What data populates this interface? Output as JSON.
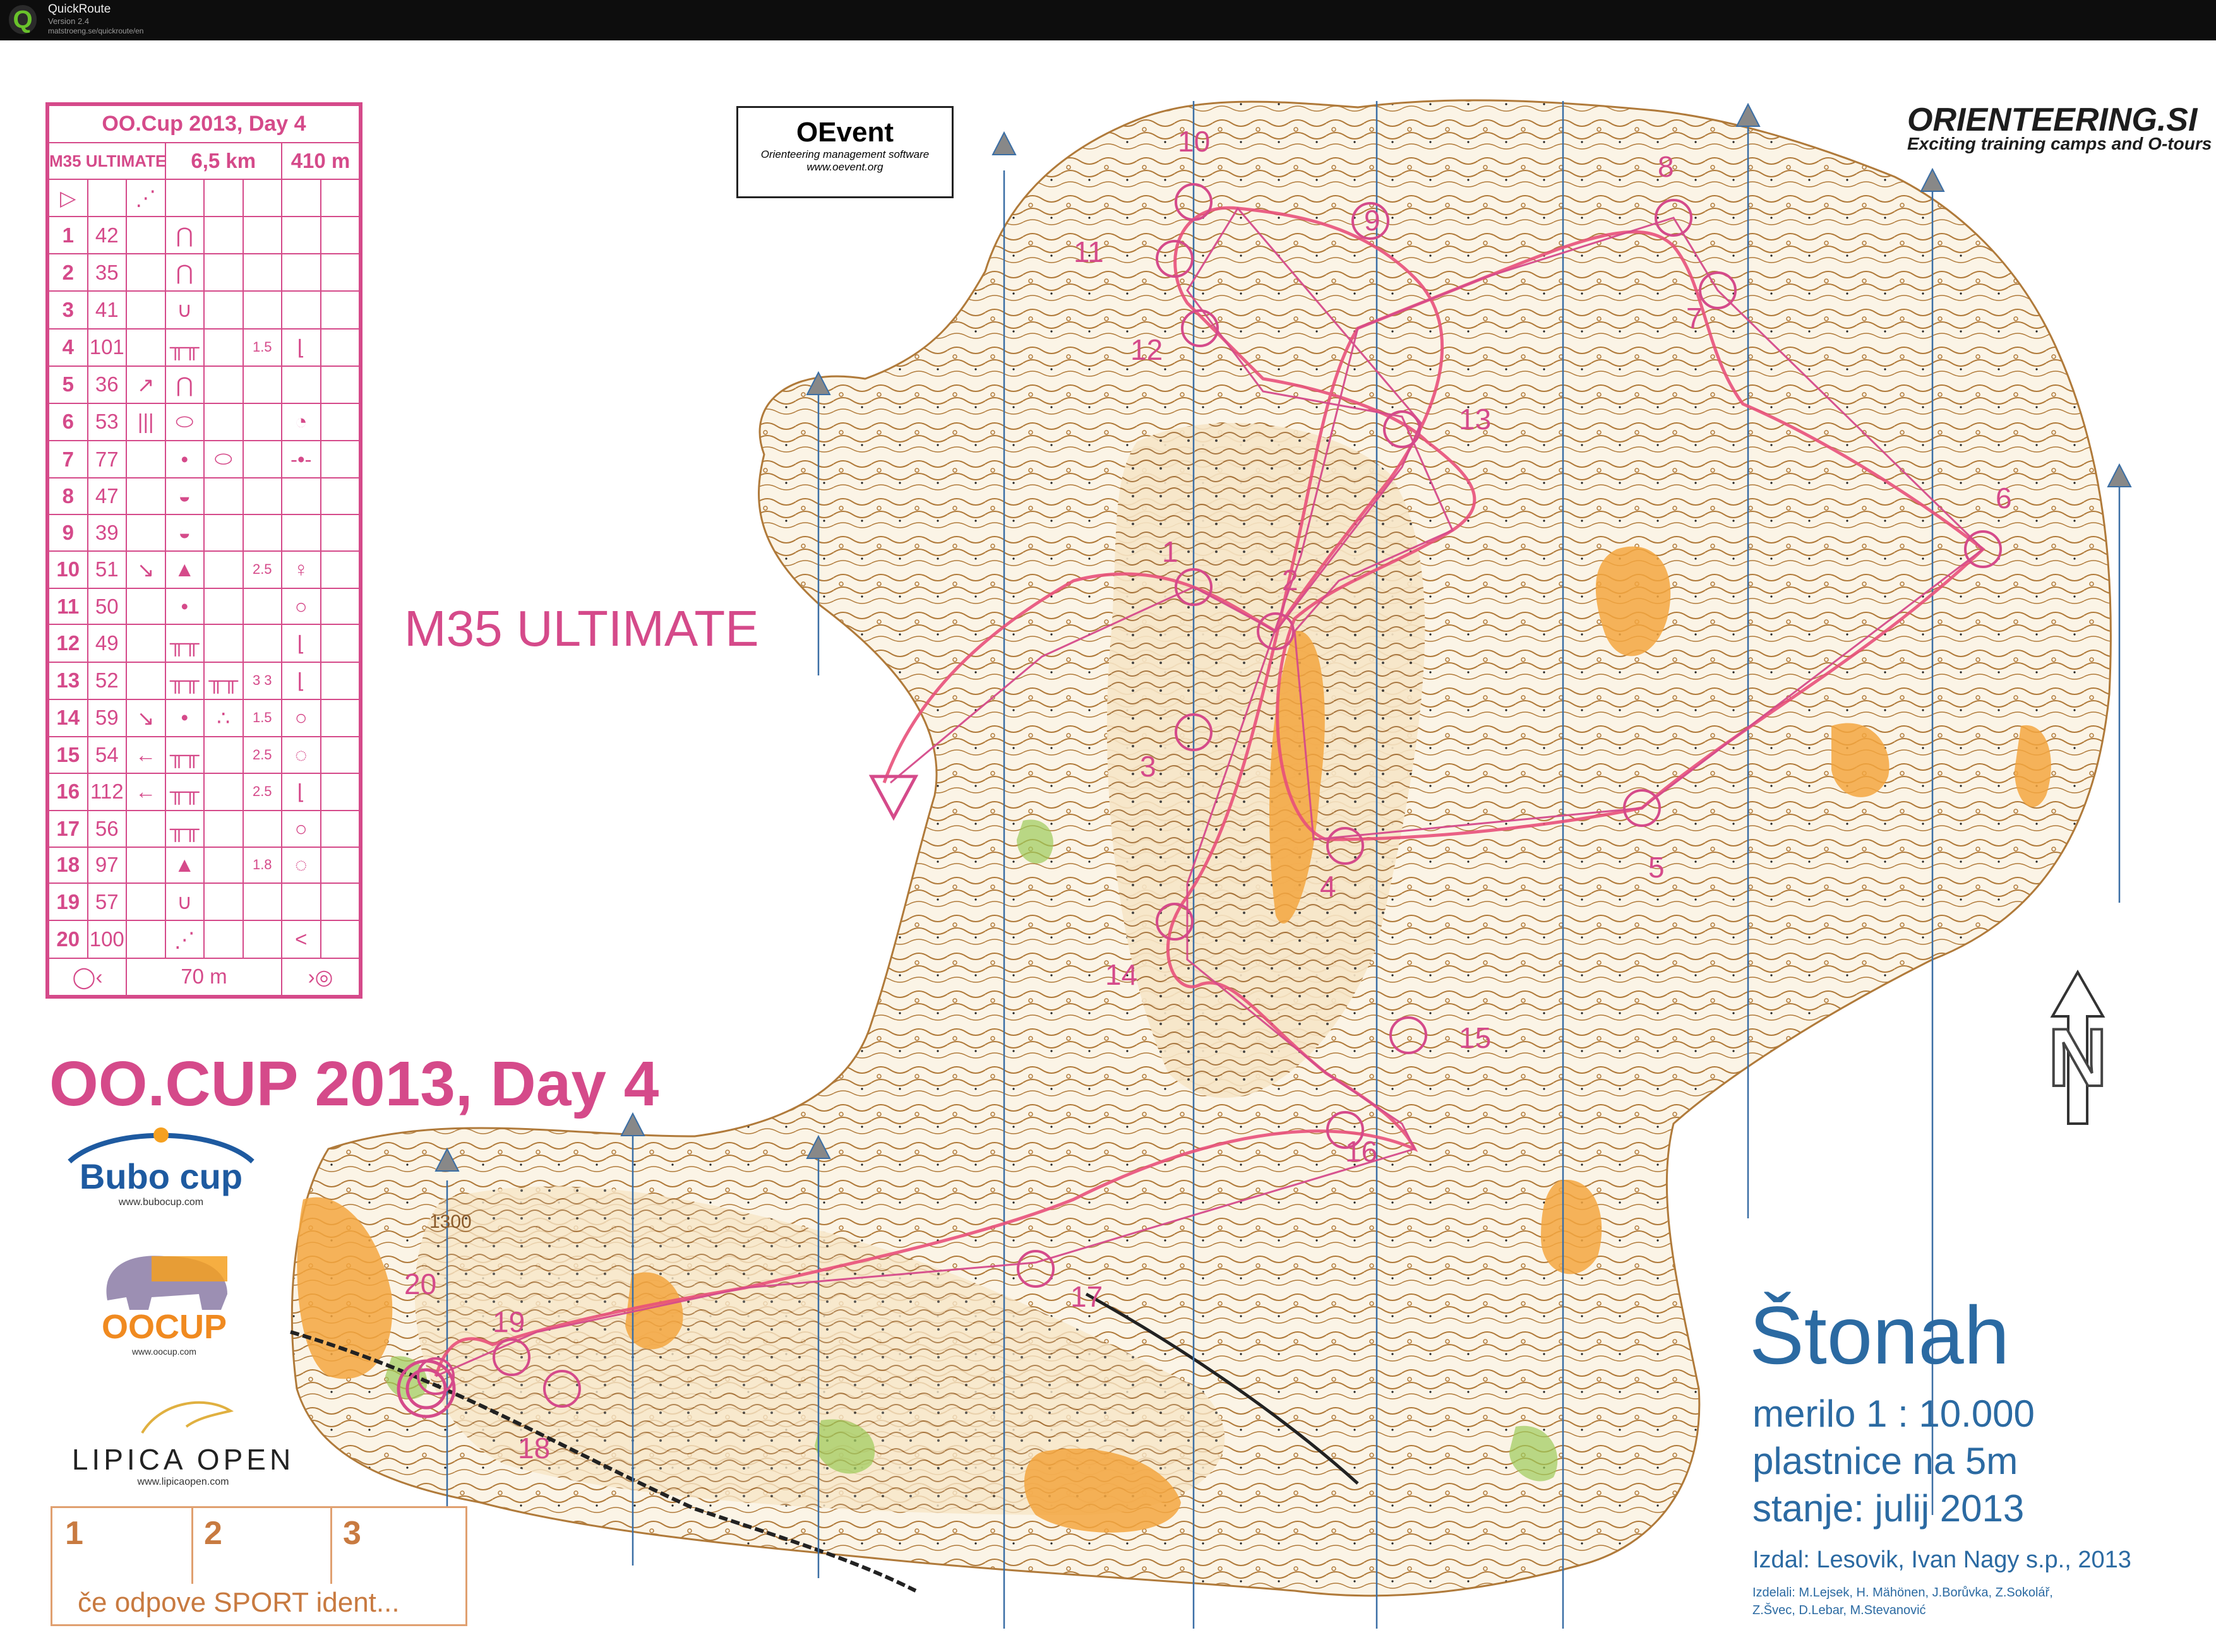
{
  "window": {
    "title": "QuickRoute",
    "version": "Version 2.4",
    "url": "matstroeng.se/quickroute/en",
    "icon": "quickroute-q-icon"
  },
  "course_card": {
    "title": "OO.Cup 2013, Day 4",
    "class": "M35 ULTIMATE",
    "length": "6,5 km",
    "climb": "410 m",
    "controls": [
      {
        "n": "1",
        "code": "42",
        "c1": "",
        "c2": "bump",
        "c3": "",
        "c4": "",
        "c5": ""
      },
      {
        "n": "2",
        "code": "35",
        "c1": "",
        "c2": "bump",
        "c3": "",
        "c4": "",
        "c5": ""
      },
      {
        "n": "3",
        "code": "41",
        "c1": "",
        "c2": "gully",
        "c3": "",
        "c4": "",
        "c5": ""
      },
      {
        "n": "4",
        "code": "101",
        "c1": "",
        "c2": "cliff",
        "c3": "",
        "c4": "1.5",
        "c5": "foot"
      },
      {
        "n": "5",
        "code": "36",
        "c1": "↗",
        "c2": "bump",
        "c3": "",
        "c4": "",
        "c5": ""
      },
      {
        "n": "6",
        "code": "53",
        "c1": "|||",
        "c2": "oval",
        "c3": "",
        "c4": "",
        "c5": "part"
      },
      {
        "n": "7",
        "code": "77",
        "c1": "",
        "c2": "•",
        "c3": "oval",
        "c4": "",
        "c5": "between"
      },
      {
        "n": "8",
        "code": "47",
        "c1": "",
        "c2": "depression",
        "c3": "",
        "c4": "",
        "c5": ""
      },
      {
        "n": "9",
        "code": "39",
        "c1": "",
        "c2": "depression",
        "c3": "",
        "c4": "",
        "c5": ""
      },
      {
        "n": "10",
        "code": "51",
        "c1": "↘",
        "c2": "▲",
        "c3": "",
        "c4": "2.5",
        "c5": "top"
      },
      {
        "n": "11",
        "code": "50",
        "c1": "",
        "c2": "•",
        "c3": "",
        "c4": "",
        "c5": "side"
      },
      {
        "n": "12",
        "code": "49",
        "c1": "",
        "c2": "cliff",
        "c3": "",
        "c4": "",
        "c5": "foot"
      },
      {
        "n": "13",
        "code": "52",
        "c1": "",
        "c2": "cliff",
        "c3": "cliff",
        "c4": "3 3",
        "c5": "foot"
      },
      {
        "n": "14",
        "code": "59",
        "c1": "↘",
        "c2": "•",
        "c3": "boulders",
        "c4": "1.5",
        "c5": "side"
      },
      {
        "n": "15",
        "code": "54",
        "c1": "←",
        "c2": "cliff",
        "c3": "",
        "c4": "2.5",
        "c5": "corner"
      },
      {
        "n": "16",
        "code": "112",
        "c1": "←",
        "c2": "cliff",
        "c3": "",
        "c4": "2.5",
        "c5": "foot"
      },
      {
        "n": "17",
        "code": "56",
        "c1": "",
        "c2": "cliff",
        "c3": "",
        "c4": "",
        "c5": "side"
      },
      {
        "n": "18",
        "code": "97",
        "c1": "",
        "c2": "▲",
        "c3": "",
        "c4": "1.8",
        "c5": "corner"
      },
      {
        "n": "19",
        "code": "57",
        "c1": "",
        "c2": "gully",
        "c3": "",
        "c4": "",
        "c5": ""
      },
      {
        "n": "20",
        "code": "100",
        "c1": "",
        "c2": "path",
        "c3": "",
        "c4": "",
        "c5": "<"
      }
    ],
    "finish_distance": "70 m"
  },
  "class_label": "M35 ULTIMATE",
  "event_title": "OO.CUP 2013, Day 4",
  "oevent": {
    "name": "OEvent",
    "subtitle": "Orienteering management software",
    "url": "www.oevent.org"
  },
  "orienteering_si": {
    "name": "ORIENTEERING.SI",
    "tagline": "Exciting training camps and O-tours"
  },
  "sponsors": {
    "bubo": {
      "name": "Bubo cup",
      "url": "www.bubocup.com"
    },
    "oocup": {
      "name": "OOCUP",
      "url": "www.oocup.com"
    },
    "lipica": {
      "name": "LIPICA OPEN",
      "url": "www.lipicaopen.com"
    }
  },
  "map_info": {
    "name": "Štonah",
    "scale": "merilo 1 : 10.000",
    "contours": "plastnice na 5m",
    "date": "stanje: julij 2013",
    "publisher": "Izdal: Lesovik, Ivan Nagy s.p., 2013",
    "makers_line1": "Izdelali: M.Lejsek, H. Mähönen, J.Borůvka, Z.Sokolář,",
    "makers_line2": "Z.Švec, D.Lebar, M.Stevanović"
  },
  "punch_box": {
    "cells": [
      "1",
      "2",
      "3"
    ],
    "note": "če odpove SPORT ident..."
  },
  "map_numbers": {
    "c1": "1",
    "c2": "2",
    "c3": "3",
    "c4": "4",
    "c5": "5",
    "c6": "6",
    "c7": "7",
    "c8": "8",
    "c9": "9",
    "c10": "10",
    "c11": "11",
    "c12": "12",
    "c13": "13",
    "c14": "14",
    "c15": "15",
    "c16": "16",
    "c17": "17",
    "c18": "18",
    "c19": "19",
    "c20": "20",
    "height": "1300"
  },
  "colors": {
    "course": "#d54a8a",
    "route": "#e8507a",
    "contour": "#b07a3a",
    "vegetation": "#f3a640",
    "magnetic_north": "#3a6ea5",
    "title_blue": "#2b6aa2"
  }
}
